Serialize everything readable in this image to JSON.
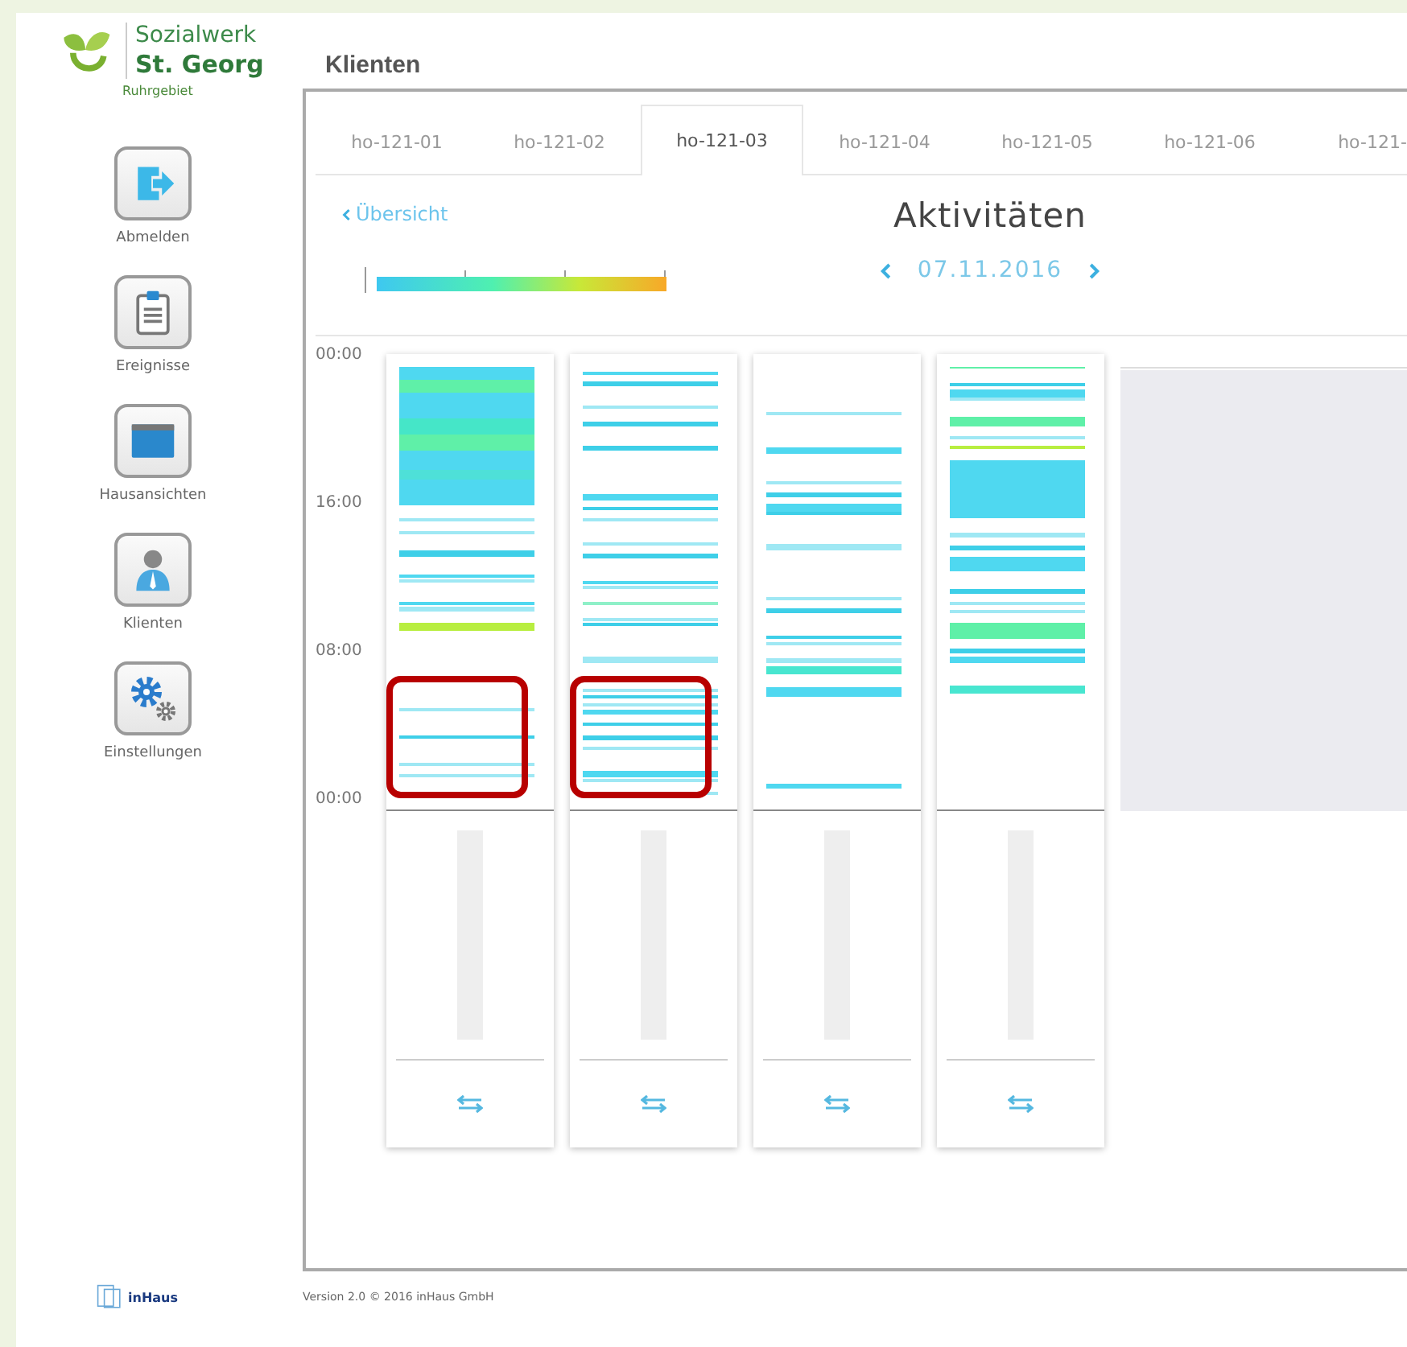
{
  "brand": {
    "name_line1": "Sozialwerk",
    "name_line2": "St. Georg",
    "region": "Ruhrgebiet"
  },
  "nav": [
    {
      "kind": "logout",
      "label": "Abmelden"
    },
    {
      "kind": "events",
      "label": "Ereignisse"
    },
    {
      "kind": "house",
      "label": "Hausansichten"
    },
    {
      "kind": "clients",
      "label": "Klienten"
    },
    {
      "kind": "settings",
      "label": "Einstellungen"
    }
  ],
  "page_title": "Klienten",
  "tabs": [
    {
      "label": "ho-121-01",
      "selected": false
    },
    {
      "label": "ho-121-02",
      "selected": false
    },
    {
      "label": "ho-121-03",
      "selected": true
    },
    {
      "label": "ho-121-04",
      "selected": false
    },
    {
      "label": "ho-121-05",
      "selected": false
    },
    {
      "label": "ho-121-06",
      "selected": false
    },
    {
      "label": "ho-121-",
      "selected": false
    }
  ],
  "back_link": "Übersicht",
  "heading": "Aktivitäten",
  "date": "07.11.2016",
  "time_axis": [
    "00:00",
    "16:00",
    "08:00",
    "00:00"
  ],
  "columns": [
    {
      "highlighted": true
    },
    {
      "highlighted": true
    },
    {
      "highlighted": false
    },
    {
      "highlighted": false
    }
  ],
  "footer": {
    "vendor_logo": "inHaus",
    "version": "Version 2.0 © 2016 inHaus GmbH"
  }
}
